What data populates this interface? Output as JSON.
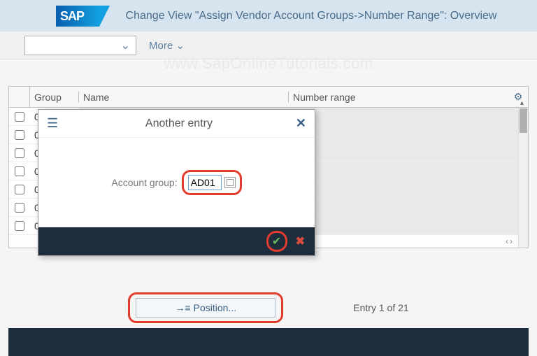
{
  "header": {
    "logo_text": "SAP",
    "title": "Change View \"Assign Vendor Account Groups->Number Range\": Overview"
  },
  "toolbar": {
    "more_label": "More",
    "watermark": "www.SapOnlineTutorials.com"
  },
  "table": {
    "columns": {
      "group": "Group",
      "name": "Name",
      "number_range": "Number range"
    },
    "rows": [
      {
        "group": "0"
      },
      {
        "group": "0"
      },
      {
        "group": "0"
      },
      {
        "group": "0"
      },
      {
        "group": "0"
      },
      {
        "group": "0"
      },
      {
        "group": "0"
      }
    ]
  },
  "popup": {
    "title": "Another entry",
    "label": "Account group:",
    "value": "AD01"
  },
  "footer": {
    "position_label": "Position...",
    "entry_text": "Entry 1 of 21"
  }
}
